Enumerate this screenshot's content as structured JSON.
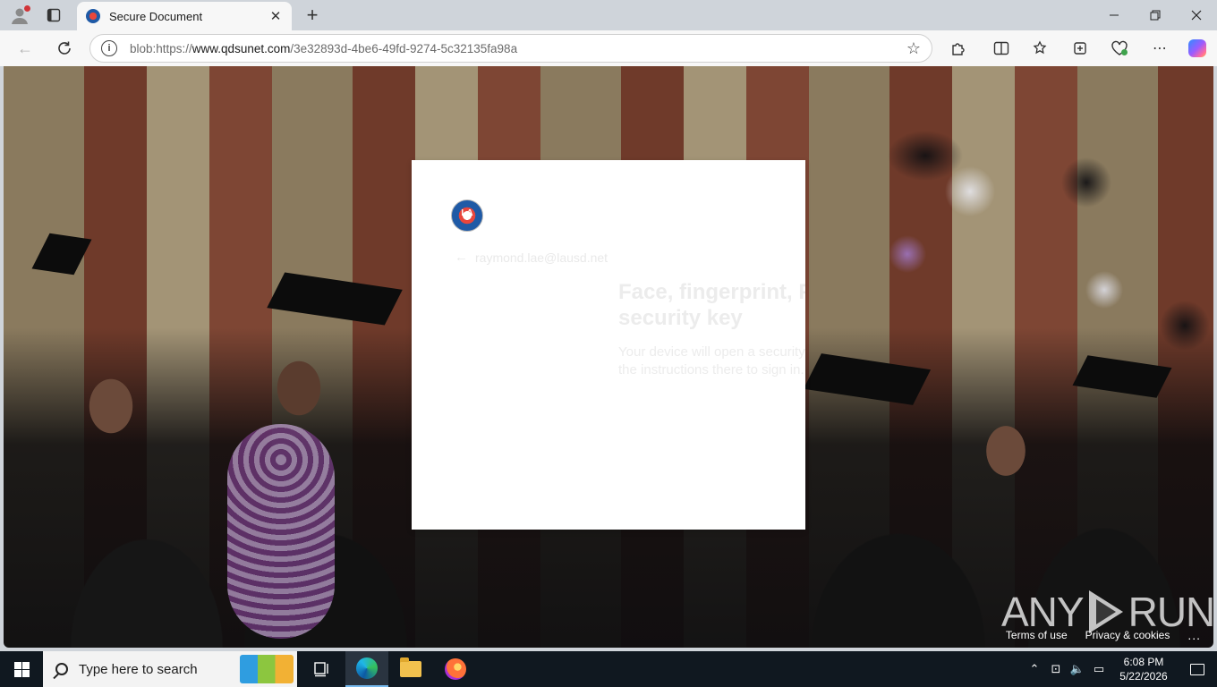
{
  "browser": {
    "tab": {
      "title": "Secure Document"
    },
    "address": {
      "prefix": "blob:https://",
      "host": "www.qdsunet.com",
      "path": "/3e32893d-4be6-49fd-9274-5c32135fa98a"
    }
  },
  "signin_card": {
    "logo_text": "LA",
    "account_email": "raymond.lae@lausd.net",
    "heading": "Face, fingerprint, PIN, or security key",
    "description": "Your device will open a security window. Follow the instructions there to sign in."
  },
  "footer": {
    "terms": "Terms of use",
    "privacy": "Privacy & cookies",
    "more": "..."
  },
  "watermark": {
    "left": "ANY",
    "right": "RUN"
  },
  "taskbar": {
    "search_placeholder": "Type here to search",
    "time": "6:08 PM",
    "date": "5/22/2026"
  },
  "colors": {
    "load_bar": "#f7894a",
    "taskbar": "#101820",
    "chrome": "#cfd4da"
  }
}
